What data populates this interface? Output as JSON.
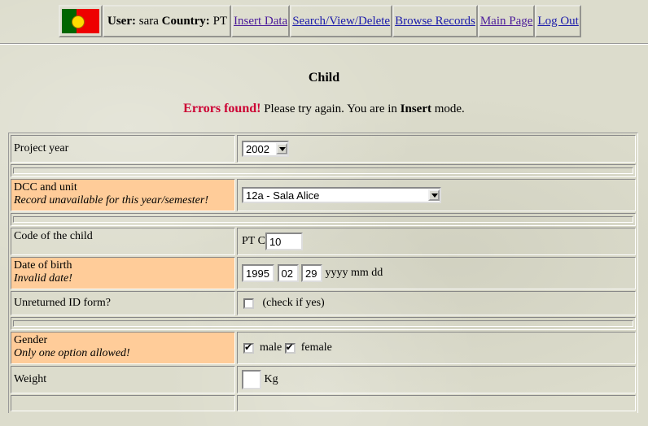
{
  "header": {
    "user_label": "User:",
    "user": "sara",
    "country_label": "Country:",
    "country": "PT",
    "links": [
      "Insert Data",
      "Search/View/Delete",
      "Browse Records",
      "Main Page",
      "Log Out"
    ]
  },
  "page_title": "Child",
  "message": {
    "error": "Errors found!",
    "text_before_mode": "Please try again. You are in",
    "mode": "Insert",
    "text_after_mode": "mode."
  },
  "form": {
    "project_year": {
      "label": "Project year",
      "value": "2002"
    },
    "dcc_unit": {
      "label": "DCC and unit",
      "error": "Record unavailable for this year/semester!",
      "value": "12a - Sala Alice"
    },
    "code": {
      "label": "Code of the child",
      "prefix": "PT C",
      "value": "10"
    },
    "dob": {
      "label": "Date of birth",
      "error": "Invalid date!",
      "yyyy": "1995",
      "mm": "02",
      "dd": "29",
      "hint": "yyyy mm dd"
    },
    "unreturned": {
      "label": "Unreturned ID form?",
      "hint": "(check if yes)",
      "checked": false
    },
    "gender": {
      "label": "Gender",
      "error": "Only one option allowed!",
      "male": "male",
      "female": "female",
      "male_checked": true,
      "female_checked": true
    },
    "weight": {
      "label": "Weight",
      "value": "",
      "unit": "Kg"
    }
  }
}
